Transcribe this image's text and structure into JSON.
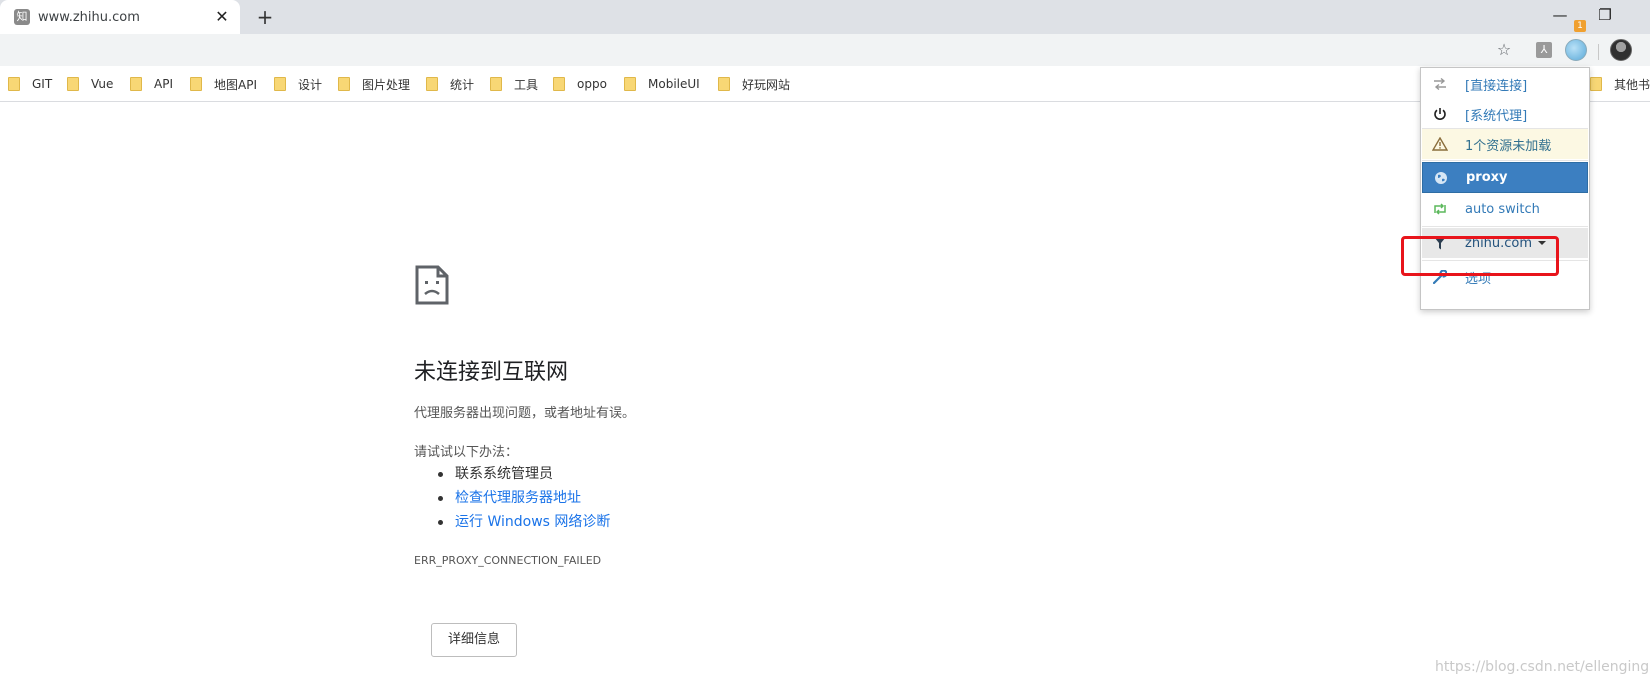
{
  "tab": {
    "favicon_text": "知",
    "title": "www.zhihu.com",
    "close_glyph": "✕"
  },
  "newtab_glyph": "+",
  "window_controls": {
    "minimize": "—",
    "restore": "❐",
    "close": "✕"
  },
  "toolbar": {
    "star_glyph": "☆",
    "pdf_glyph": "⅄",
    "extension_badge": "1"
  },
  "bookmarks": {
    "items": [
      {
        "label": "GIT"
      },
      {
        "label": "Vue"
      },
      {
        "label": "API"
      },
      {
        "label": "地图API"
      },
      {
        "label": "设计"
      },
      {
        "label": "图片处理"
      },
      {
        "label": "统计"
      },
      {
        "label": "工具"
      },
      {
        "label": "oppo"
      },
      {
        "label": "MobileUI"
      },
      {
        "label": "好玩网站"
      }
    ],
    "other": "其他书"
  },
  "error": {
    "title": "未连接到互联网",
    "description": "代理服务器出现问题，或者地址有误。",
    "try_label": "请试试以下办法：",
    "suggestions": [
      {
        "text": "联系系统管理员",
        "link": false
      },
      {
        "text": "检查代理服务器地址",
        "link": true
      },
      {
        "text": "运行 Windows 网络诊断",
        "link": true
      }
    ],
    "code": "ERR_PROXY_CONNECTION_FAILED",
    "details_button": "详细信息"
  },
  "proxy_menu": {
    "items": [
      {
        "label": "[直接连接]",
        "icon": "transfer-icon"
      },
      {
        "label": "[系统代理]",
        "icon": "power-icon"
      },
      {
        "label": "1个资源未加载",
        "icon": "warning-icon"
      },
      {
        "label": "proxy",
        "icon": "globe-icon",
        "active": true
      },
      {
        "label": "auto switch",
        "icon": "retweet-icon"
      },
      {
        "label": "zhihu.com",
        "icon": "filter-icon"
      },
      {
        "label": "选项",
        "icon": "wrench-icon"
      }
    ]
  },
  "watermark": "https://blog.csdn.net/ellenging",
  "colors": {
    "accent": "#3c7fc1",
    "link": "#1a73e8",
    "highlight_box": "#e8141b",
    "warning_bg": "#fcf8e3"
  }
}
